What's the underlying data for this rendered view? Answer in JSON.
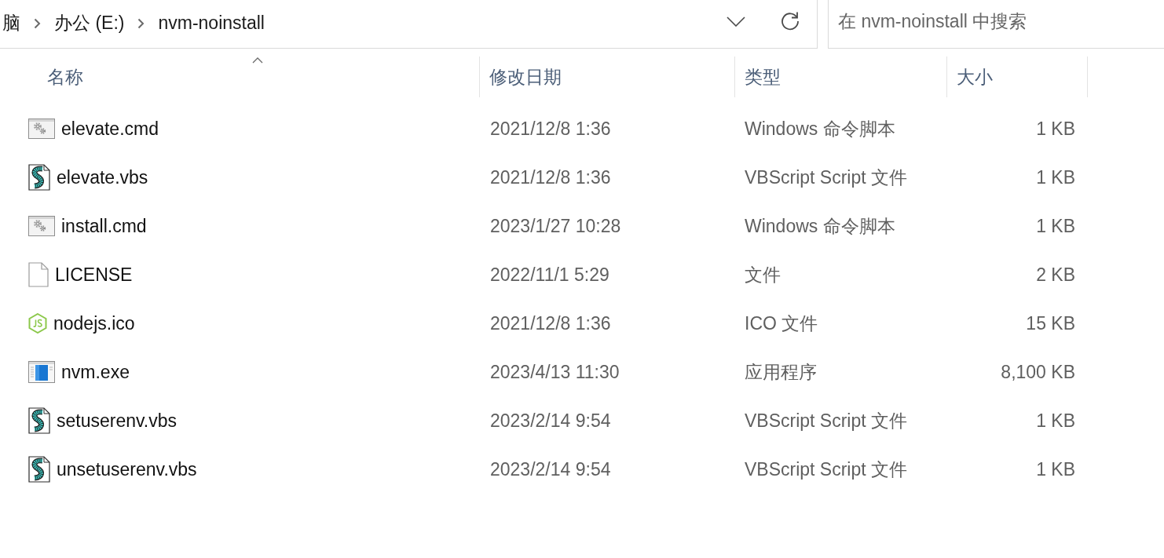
{
  "address_bar": {
    "breadcrumbs": [
      {
        "label": "脑"
      },
      {
        "label": "办公 (E:)"
      },
      {
        "label": "nvm-noinstall"
      }
    ]
  },
  "search": {
    "placeholder": "在 nvm-noinstall 中搜索"
  },
  "table": {
    "columns": [
      {
        "label": "名称",
        "sorted": true
      },
      {
        "label": "修改日期",
        "sorted": false
      },
      {
        "label": "类型",
        "sorted": false
      },
      {
        "label": "大小",
        "sorted": false
      }
    ],
    "rows": [
      {
        "kind": "cmd",
        "name": "elevate.cmd",
        "modified": "2021/12/8 1:36",
        "type": "Windows 命令脚本",
        "size": "1 KB"
      },
      {
        "kind": "vbs",
        "name": "elevate.vbs",
        "modified": "2021/12/8 1:36",
        "type": "VBScript Script 文件",
        "size": "1 KB"
      },
      {
        "kind": "cmd",
        "name": "install.cmd",
        "modified": "2023/1/27 10:28",
        "type": "Windows 命令脚本",
        "size": "1 KB"
      },
      {
        "kind": "file",
        "name": "LICENSE",
        "modified": "2022/11/1 5:29",
        "type": "文件",
        "size": "2 KB"
      },
      {
        "kind": "nodejs",
        "name": "nodejs.ico",
        "modified": "2021/12/8 1:36",
        "type": "ICO 文件",
        "size": "15 KB"
      },
      {
        "kind": "exe",
        "name": "nvm.exe",
        "modified": "2023/4/13 11:30",
        "type": "应用程序",
        "size": "8,100 KB"
      },
      {
        "kind": "vbs",
        "name": "setuserenv.vbs",
        "modified": "2023/2/14 9:54",
        "type": "VBScript Script 文件",
        "size": "1 KB"
      },
      {
        "kind": "vbs",
        "name": "unsetuserenv.vbs",
        "modified": "2023/2/14 9:54",
        "type": "VBScript Script 文件",
        "size": "1 KB"
      }
    ]
  }
}
